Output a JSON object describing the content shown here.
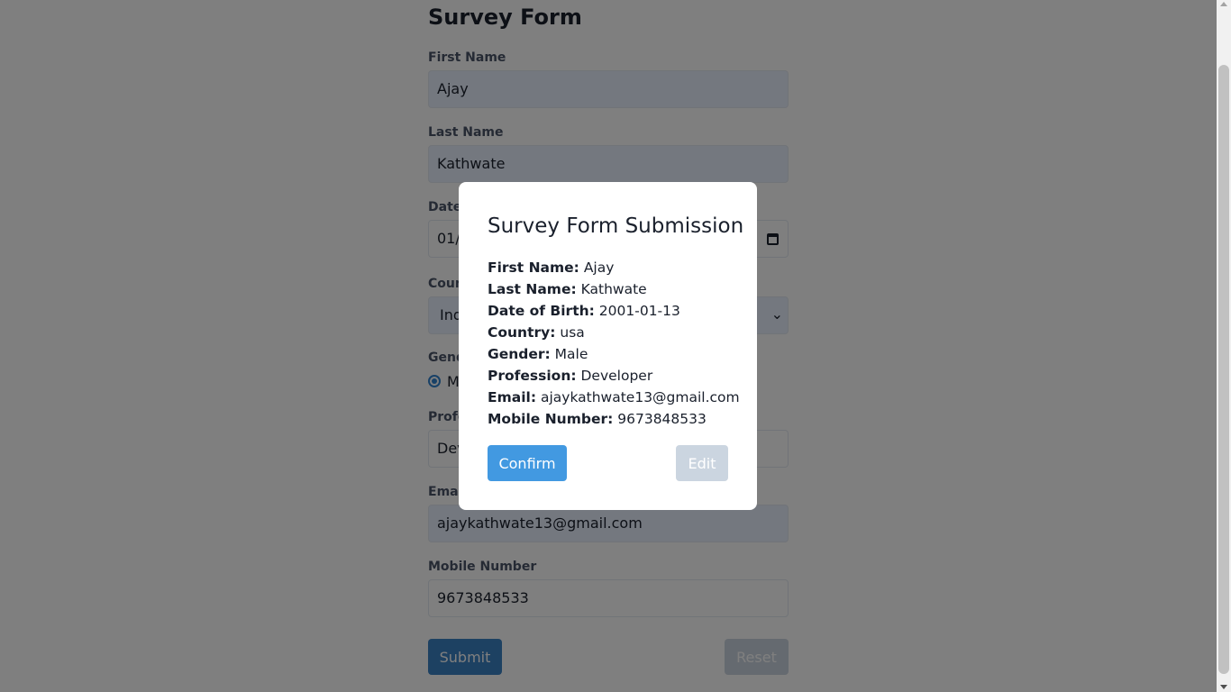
{
  "form": {
    "title": "Survey Form",
    "first_name_label": "First Name",
    "first_name_value": "Ajay",
    "last_name_label": "Last Name",
    "last_name_value": "Kathwate",
    "dob_label": "Date",
    "dob_value": "01/",
    "country_label": "Coun",
    "country_value": "Ind",
    "gender_label": "Gend",
    "gender_option": "M",
    "profession_label": "Profe",
    "profession_value": "Dev",
    "email_label": "Email",
    "email_value": "ajaykathwate13@gmail.com",
    "mobile_label": "Mobile Number",
    "mobile_value": "9673848533",
    "submit_label": "Submit",
    "reset_label": "Reset"
  },
  "modal": {
    "title": "Survey Form Submission",
    "rows": [
      {
        "key": "First Name:",
        "value": "Ajay"
      },
      {
        "key": "Last Name:",
        "value": "Kathwate"
      },
      {
        "key": "Date of Birth:",
        "value": "2001-01-13"
      },
      {
        "key": "Country:",
        "value": "usa"
      },
      {
        "key": "Gender:",
        "value": "Male"
      },
      {
        "key": "Profession:",
        "value": "Developer"
      },
      {
        "key": "Email:",
        "value": "ajaykathwate13@gmail.com"
      },
      {
        "key": "Mobile Number:",
        "value": "9673848533"
      }
    ],
    "confirm_label": "Confirm",
    "edit_label": "Edit"
  },
  "colors": {
    "primary": "#4299e1",
    "submit": "#3b82c4",
    "disabled": "#cbd5e0",
    "autofill": "#e8f0fe"
  },
  "icons": [
    "calendar-icon",
    "chevron-down-icon",
    "radio-checked-icon"
  ]
}
